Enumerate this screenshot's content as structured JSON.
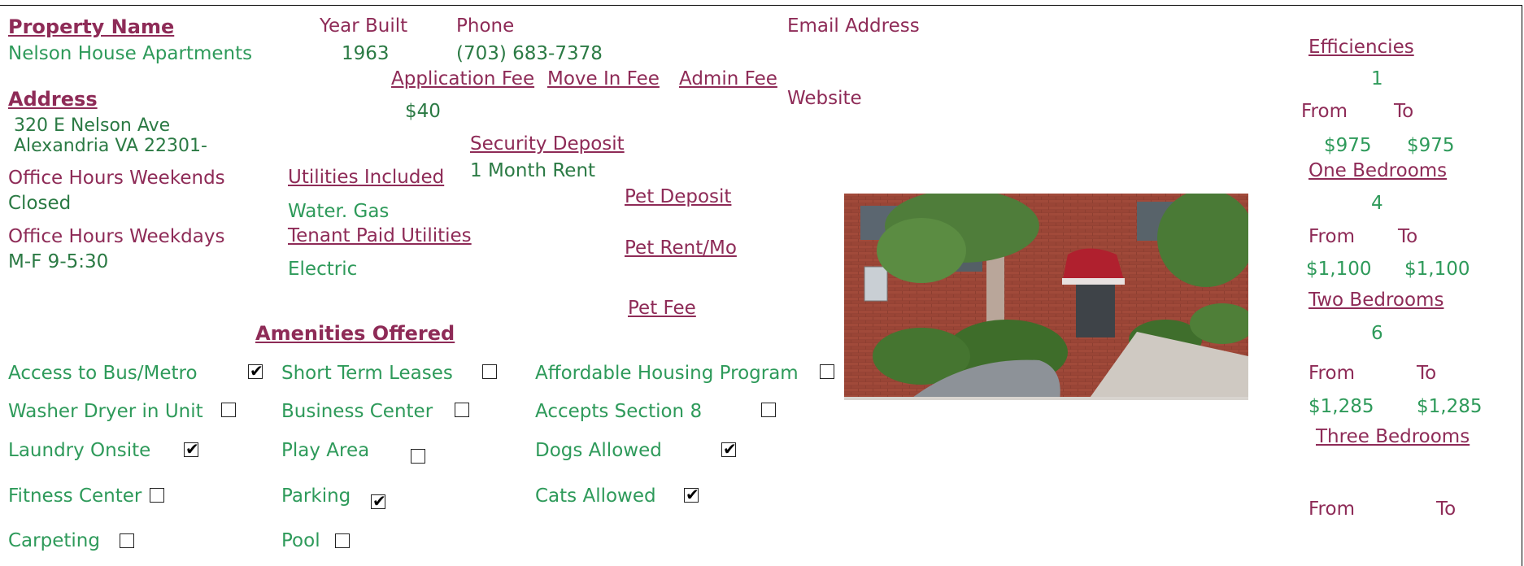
{
  "property": {
    "name_label": "Property Name",
    "name": "Nelson House Apartments",
    "address_label": "Address",
    "address_line1": "320 E Nelson Ave",
    "address_line2": "Alexandria VA 22301-",
    "year_built_label": "Year Built",
    "year_built": "1963",
    "phone_label": "Phone",
    "phone": "(703) 683-7378",
    "email_label": "Email Address",
    "website_label": "Website"
  },
  "hours": {
    "weekends_label": "Office Hours Weekends",
    "weekends": "Closed",
    "weekdays_label": "Office Hours Weekdays",
    "weekdays": "M-F 9-5:30"
  },
  "fees": {
    "application_label": "Application Fee",
    "application": "$40",
    "move_in_label": "Move In Fee",
    "admin_label": "Admin Fee",
    "security_label": "Security Deposit",
    "security": "1 Month Rent",
    "pet_deposit_label": "Pet Deposit",
    "pet_rent_label": "Pet Rent/Mo",
    "pet_fee_label": "Pet Fee"
  },
  "utilities": {
    "included_label": "Utilities Included",
    "included": "Water. Gas",
    "tenant_label": "Tenant Paid Utilities",
    "tenant": "Electric"
  },
  "amenities_title": "Amenities Offered",
  "amenities": [
    {
      "label": "Access to Bus/Metro",
      "checked": true
    },
    {
      "label": "Washer Dryer in Unit",
      "checked": false
    },
    {
      "label": "Laundry Onsite",
      "checked": true
    },
    {
      "label": "Fitness Center",
      "checked": false
    },
    {
      "label": "Carpeting",
      "checked": false
    },
    {
      "label": "Short Term Leases",
      "checked": false
    },
    {
      "label": "Business Center",
      "checked": false
    },
    {
      "label": "Play Area",
      "checked": false
    },
    {
      "label": "Parking",
      "checked": true
    },
    {
      "label": "Pool",
      "checked": false
    },
    {
      "label": "Affordable Housing Program",
      "checked": false
    },
    {
      "label": "Accepts Section 8",
      "checked": false
    },
    {
      "label": "Dogs Allowed",
      "checked": true
    },
    {
      "label": "Cats Allowed",
      "checked": true
    }
  ],
  "units": {
    "from_label": "From",
    "to_label": "To",
    "efficiencies": {
      "label": "Efficiencies ",
      "count": "1",
      "from": "$975",
      "to": "$975"
    },
    "one_bedrooms": {
      "label": "One Bedrooms",
      "count": "4",
      "from": "$1,100",
      "to": "$1,100"
    },
    "two_bedrooms": {
      "label": "Two Bedrooms",
      "count": "6",
      "from": "$1,285",
      "to": "$1,285"
    },
    "three_bedrooms": {
      "label": "Three Bedrooms"
    }
  }
}
